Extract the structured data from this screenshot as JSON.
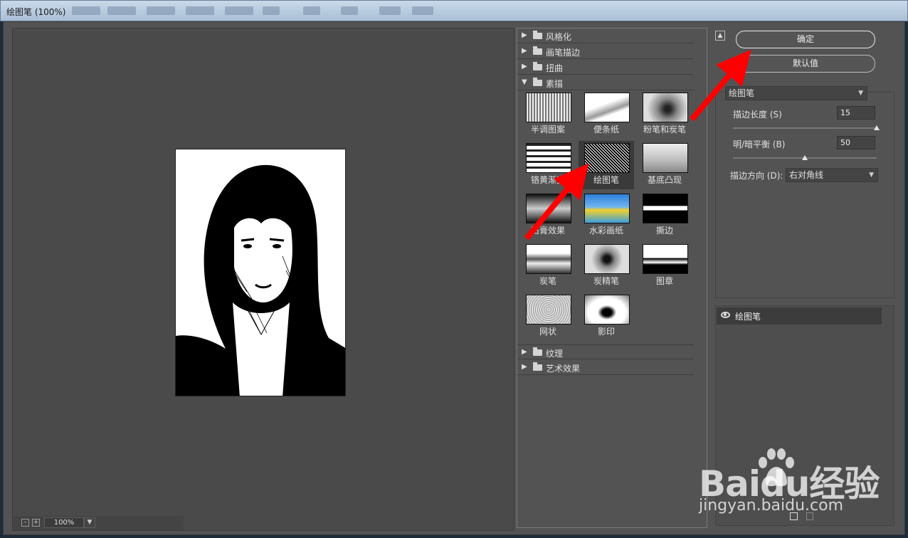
{
  "window": {
    "title": "绘图笔 (100%)"
  },
  "preview": {
    "zoom": "100%",
    "zoom_out_symbol": "-",
    "zoom_in_symbol": "+"
  },
  "filter_gallery": {
    "categories_top": [
      {
        "label": "风格化",
        "expanded": false
      },
      {
        "label": "画笔描边",
        "expanded": false
      },
      {
        "label": "扭曲",
        "expanded": false
      },
      {
        "label": "素描",
        "expanded": true
      }
    ],
    "sketch_filters": [
      {
        "label": "半调图案"
      },
      {
        "label": "便条纸"
      },
      {
        "label": "粉笔和炭笔"
      },
      {
        "label": "铬黄渐变"
      },
      {
        "label": "绘图笔",
        "selected": true
      },
      {
        "label": "基底凸现"
      },
      {
        "label": "石膏效果"
      },
      {
        "label": "水彩画纸"
      },
      {
        "label": "撕边"
      },
      {
        "label": "炭笔"
      },
      {
        "label": "炭精笔"
      },
      {
        "label": "图章"
      },
      {
        "label": "网状"
      },
      {
        "label": "影印"
      }
    ],
    "categories_bottom": [
      {
        "label": "纹理",
        "expanded": false
      },
      {
        "label": "艺术效果",
        "expanded": false
      }
    ]
  },
  "actions": {
    "ok_label": "确定",
    "default_label": "默认值"
  },
  "settings": {
    "filter_select": "绘图笔",
    "stroke_length": {
      "label": "描边长度 (S)",
      "value": "15",
      "ratio": 1.0
    },
    "light_dark_balance": {
      "label": "明/暗平衡 (B)",
      "value": "50",
      "ratio": 0.5
    },
    "stroke_direction": {
      "label": "描边方向 (D):",
      "value": "右对角线"
    }
  },
  "layers": {
    "active_layer": "绘图笔"
  },
  "watermark": {
    "brand": "Baidu经验",
    "url": "jingyan.baidu.com"
  },
  "colors": {
    "panel_bg": "#535353",
    "arrow": "#ff0000"
  }
}
